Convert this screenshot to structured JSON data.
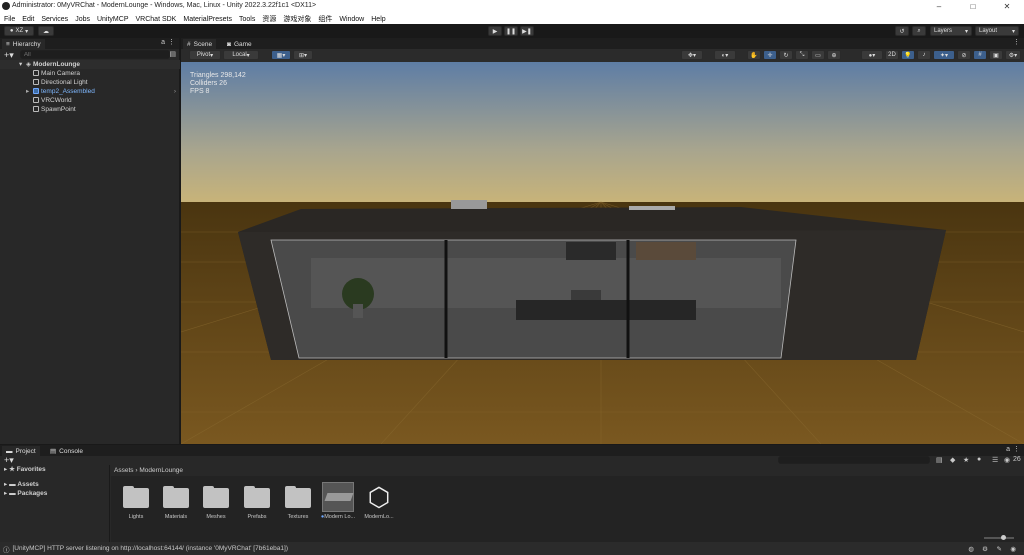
{
  "window": {
    "title": "Administrator: 0MyVRChat - ModernLounge - Windows, Mac, Linux - Unity 2022.3.22f1c1 <DX11>",
    "controls": [
      "–",
      "□",
      "✕"
    ]
  },
  "menu": [
    "File",
    "Edit",
    "Services",
    "Jobs",
    "UnityMCP",
    "VRChat SDK",
    "MaterialPresets",
    "Tools",
    "资源",
    "游戏对象",
    "组件",
    "Window",
    "Help"
  ],
  "toolbar": {
    "account": "XZ",
    "play": "▶",
    "pause": "❚❚",
    "step": "▶❚",
    "layers": "Layers",
    "layout": "Layout"
  },
  "hierarchy": {
    "tab": "Hierarchy",
    "search_placeholder": "All",
    "items": [
      {
        "label": "ModernLounge",
        "indent": 0
      },
      {
        "label": "Main Camera",
        "indent": 1
      },
      {
        "label": "Directional Light",
        "indent": 1
      },
      {
        "label": "temp2_Assembled",
        "indent": 1
      },
      {
        "label": "VRCWorld",
        "indent": 1
      },
      {
        "label": "SpawnPoint",
        "indent": 1
      }
    ]
  },
  "scene": {
    "tabs": [
      "Scene",
      "Game"
    ],
    "pivot": "Pivot",
    "local": "Local",
    "mode_2d": "2D",
    "stats": {
      "triangles": "Triangles 298,142",
      "colliders": "Colliders 26",
      "fps": "FPS 8"
    }
  },
  "bottom": {
    "tabs": [
      "Project",
      "Console"
    ],
    "tree": {
      "favorites": "★ Favorites",
      "assets": "Assets",
      "packages": "Packages"
    },
    "breadcrumb": [
      "Assets",
      "ModernLounge"
    ],
    "assets": [
      "Lights",
      "Materials",
      "Meshes",
      "Prefabs",
      "Textures",
      "Modern Lo...",
      "ModernLo..."
    ],
    "count": "26"
  },
  "status": {
    "message": "[UnityMCP] HTTP server listening on http://localhost:64144/ (instance '0MyVRChat' [7b61eba1])"
  },
  "colors": {
    "panel": "#282828",
    "ground": "#6b4c18",
    "sky_top": "#5e7da5",
    "sky_horizon": "#d4b971",
    "accent": "#4a9cff"
  }
}
